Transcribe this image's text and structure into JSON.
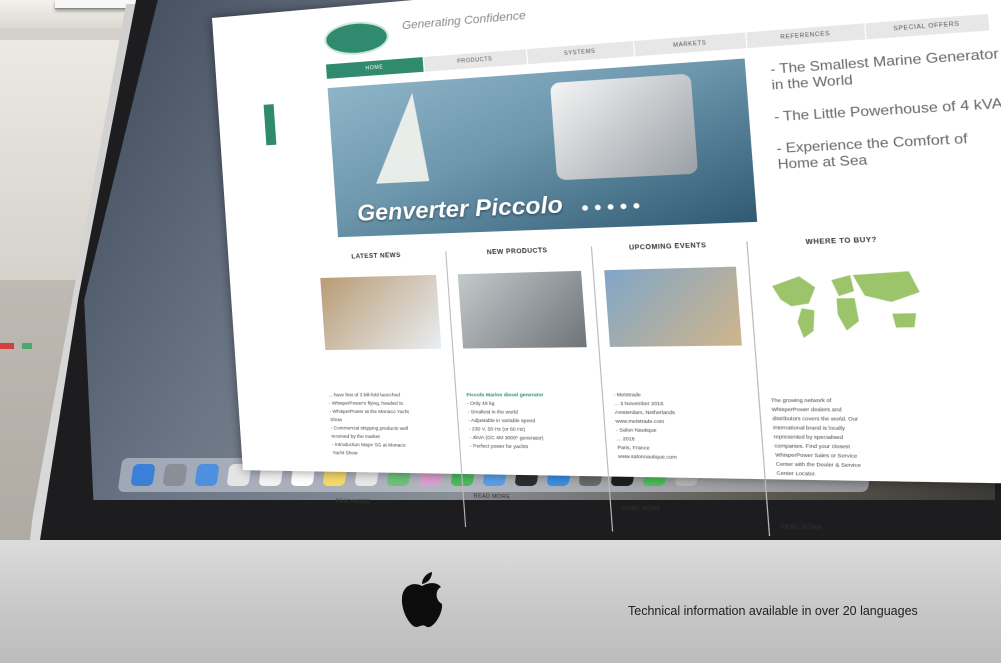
{
  "caption": "Technical information available in over 20 languages",
  "website": {
    "tagline": "Generating Confidence",
    "nav": [
      "HOME",
      "PRODUCTS",
      "SYSTEMS",
      "MARKETS",
      "REFERENCES",
      "SPECIAL OFFERS"
    ],
    "hero_title": "Genverter Piccolo",
    "hero_bullets": [
      "- The Smallest Marine Generator in the World",
      "- The Little Powerhouse of 4 kVA",
      "- Experience the Comfort of Home at Sea"
    ],
    "columns": [
      {
        "title": "LATEST NEWS",
        "lines": [
          "... have first of 3 bill-fold launched",
          "- WhisperPower's flying, headed to",
          "- WhisperPower at the Monaco Yacht",
          "Show",
          "- Commercial shipping products well",
          "received by the market",
          "- Introduction Major SG at Monaco",
          "Yacht Show"
        ],
        "read_more": "READ MORE"
      },
      {
        "title": "NEW PRODUCTS",
        "lines": [
          "Piccolo Marine diesel generator",
          "- Only 49 kg",
          "- Smallest in the world",
          "- Adjustable in variable speed",
          "- 230 V, 50 Hz (or 60 Hz)",
          "- 4kVA (GC 4M 3000* generator)",
          "- Perfect power for yachts"
        ],
        "read_more": "READ MORE"
      },
      {
        "title": "UPCOMING EVENTS",
        "lines": [
          "- Metstrade",
          "... 3 November 2016",
          "Amsterdam, Netherlands",
          "www.metstrade.com",
          "- Salon Nautique",
          "... 2016",
          "Paris, France",
          "www.salonnautique.com"
        ],
        "read_more": "READ MORE"
      },
      {
        "title": "WHERE TO BUY?",
        "lines": [
          "The growing network of",
          "WhisperPower dealers and",
          "distributors covers the world. Our",
          "international brand is locally",
          "represented by specialised",
          "companies. Find your closest",
          "WhisperPower Sales or Service",
          "Center with the Dealer & Service",
          "Center Locator."
        ],
        "read_more": "READ MORE"
      }
    ]
  },
  "colors": {
    "brand_teal": "#2f8a6e",
    "bezel": "#1d1d1f",
    "aluminum": "#d0d0d0"
  },
  "icons": [
    "apple-logo-icon"
  ]
}
